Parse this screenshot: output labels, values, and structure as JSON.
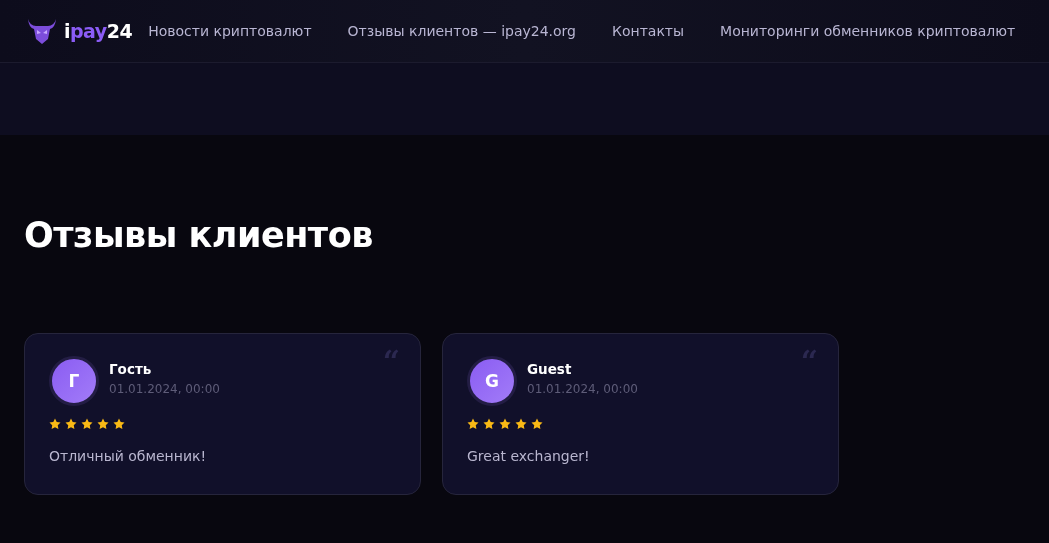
{
  "header": {
    "logo": {
      "segments": [
        {
          "text": "i",
          "color": "#ffffff"
        },
        {
          "text": "pay",
          "color": "#8b5cf6"
        },
        {
          "text": "24",
          "color": "#ffffff"
        }
      ]
    },
    "nav": [
      "Новости криптовалют",
      "Отзывы клиентов — ipay24.org",
      "Контакты",
      "Мониторинги обменников криптовалют"
    ]
  },
  "page_title": "Отзывы клиентов",
  "reviews": [
    {
      "initial": "Г",
      "name": "Гость",
      "date": "01.01.2024, 00:00",
      "stars": 5,
      "text": "Отличный обменник!",
      "quote": "“"
    },
    {
      "initial": "G",
      "name": "Guest",
      "date": "01.01.2024, 00:00",
      "stars": 5,
      "text": "Great exchanger!",
      "quote": "“"
    }
  ]
}
